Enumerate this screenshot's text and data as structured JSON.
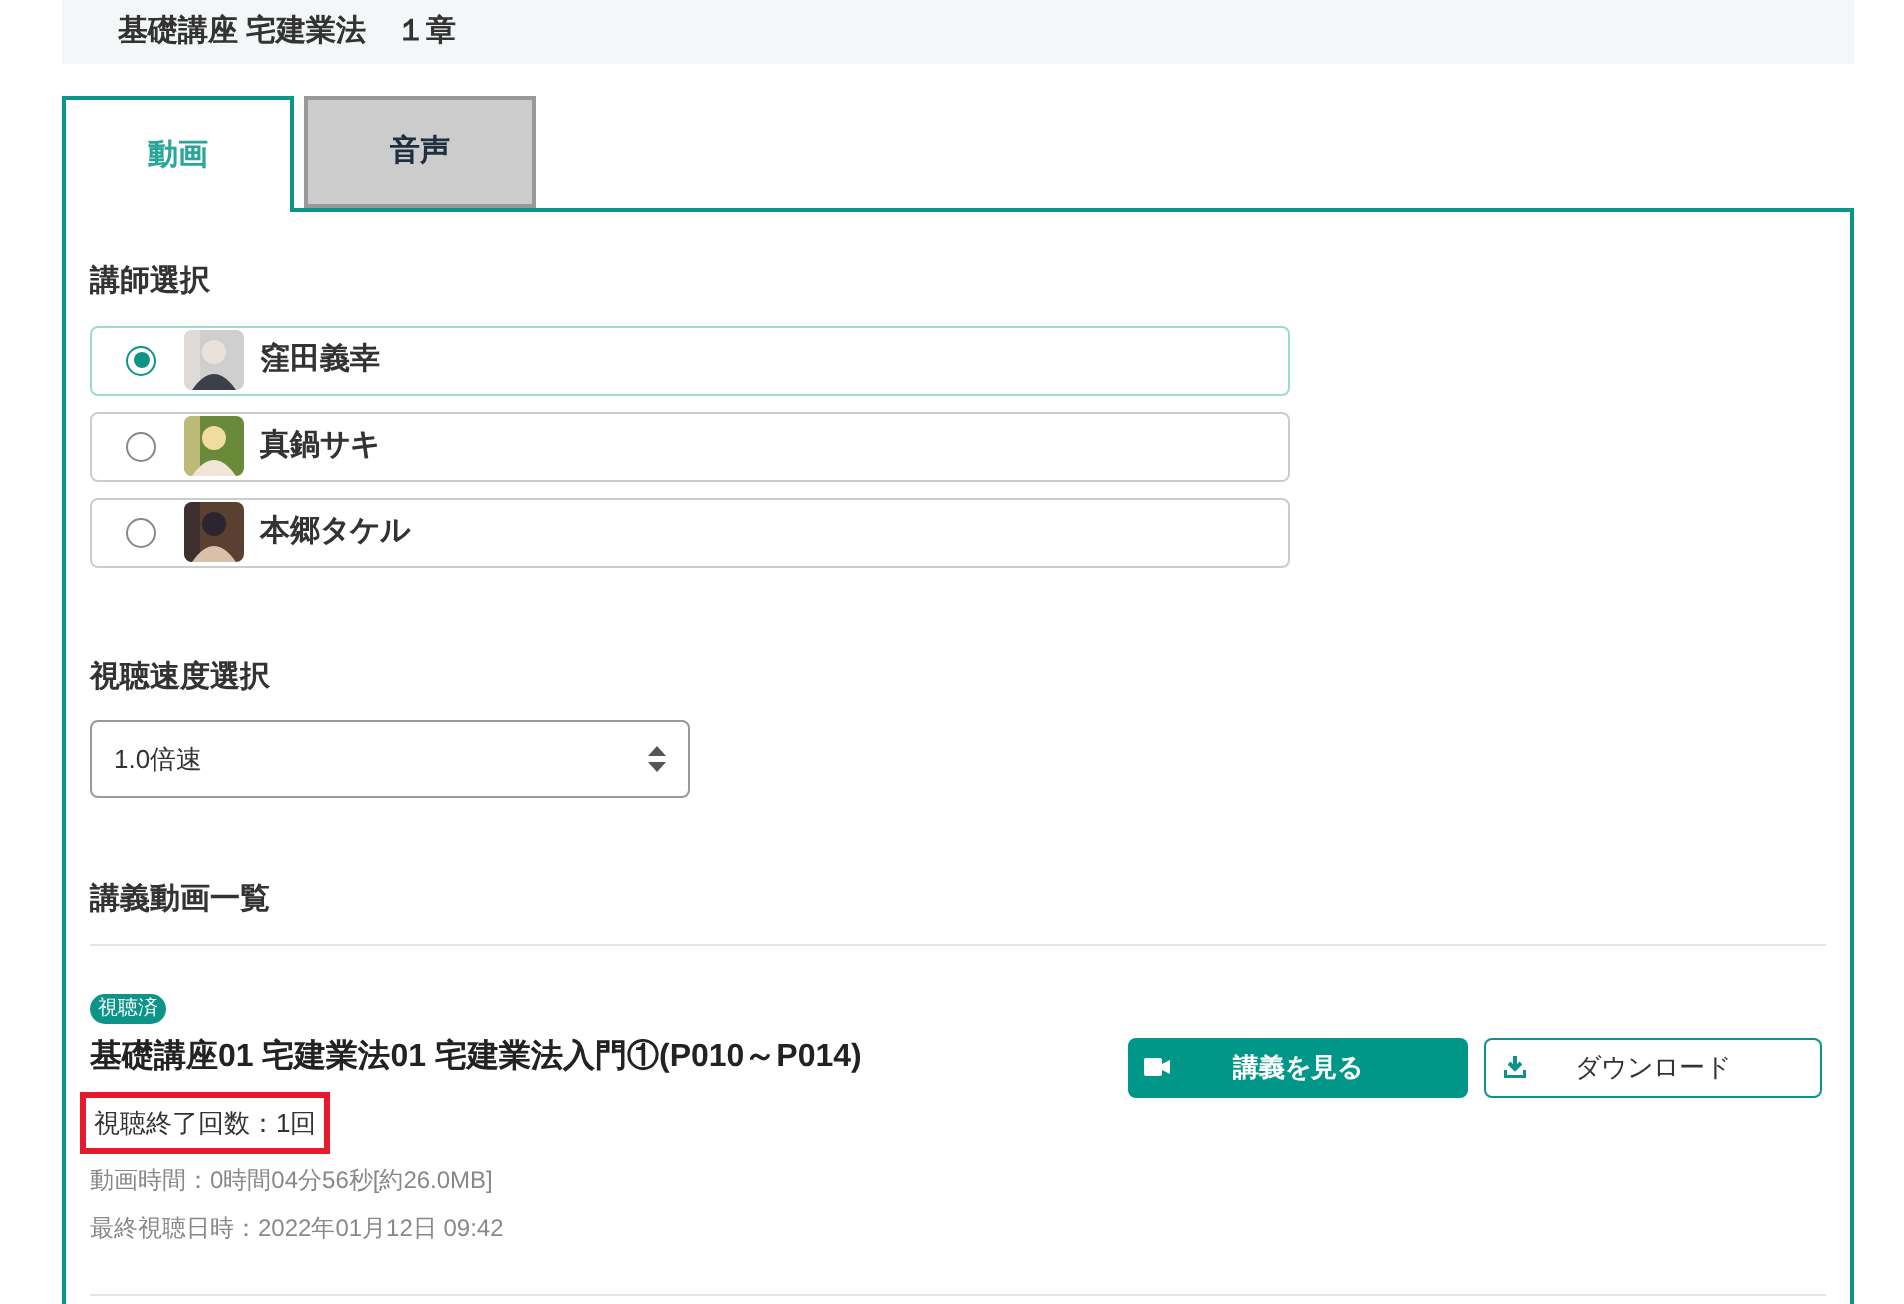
{
  "header": {
    "title": "基礎講座 宅建業法　１章"
  },
  "tabs": [
    {
      "label": "動画",
      "selected": true
    },
    {
      "label": "音声",
      "selected": false
    }
  ],
  "instructor_section": {
    "heading": "講師選択",
    "options": [
      {
        "name": "窪田義幸",
        "selected": true
      },
      {
        "name": "真鍋サキ",
        "selected": false
      },
      {
        "name": "本郷タケル",
        "selected": false
      }
    ]
  },
  "speed_section": {
    "heading": "視聴速度選択",
    "value": "1.0倍速"
  },
  "video_list": {
    "heading": "講義動画一覧",
    "items": [
      {
        "badge": "視聴済",
        "title": "基礎講座01 宅建業法01 宅建業法入門①(P010～P014)",
        "completed_count": "視聴終了回数：1回",
        "count_highlighted": true,
        "duration": "動画時間：0時間04分56秒[約26.0MB]",
        "last_viewed": "最終視聴日時：2022年01月12日 09:42",
        "watch_button": "講義を見る",
        "download_button": "ダウンロード"
      }
    ]
  }
}
